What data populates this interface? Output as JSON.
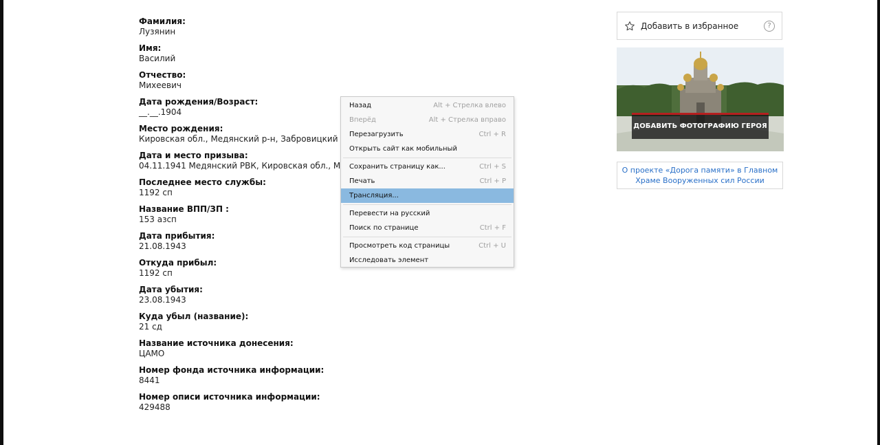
{
  "fields": [
    {
      "label": "Фамилия:",
      "value": "Лузянин"
    },
    {
      "label": "Имя:",
      "value": "Василий"
    },
    {
      "label": "Отчество:",
      "value": "Михеевич"
    },
    {
      "label": "Дата рождения/Возраст:",
      "value": "__.__.1904"
    },
    {
      "label": "Место рождения:",
      "value": "Кировская обл., Медянский р-н, Забровицкий с/с"
    },
    {
      "label": "Дата и место призыва:",
      "value": "04.11.1941 Медянский РВК, Кировская обл., Медянский р-н"
    },
    {
      "label": "Последнее место службы:",
      "value": "1192 сп"
    },
    {
      "label": "Название ВПП/ЗП :",
      "value": "153 азсп"
    },
    {
      "label": "Дата прибытия:",
      "value": "21.08.1943"
    },
    {
      "label": "Откуда прибыл:",
      "value": "1192 сп"
    },
    {
      "label": "Дата убытия:",
      "value": "23.08.1943"
    },
    {
      "label": "Куда убыл (название):",
      "value": "21 сд"
    },
    {
      "label": "Название источника донесения:",
      "value": "ЦАМО"
    },
    {
      "label": "Номер фонда источника информации:",
      "value": "8441"
    },
    {
      "label": "Номер описи источника информации:",
      "value": "429488"
    }
  ],
  "sidebar": {
    "favorite_label": "Добавить в избранное",
    "help_glyph": "?",
    "banner_cta": "ДОБАВИТЬ ФОТОГРАФИЮ ГЕРОЯ",
    "about_link": "О проекте «Дорога памяти» в Главном Храме Вооруженных сил России"
  },
  "context_menu": {
    "items": [
      {
        "label": "Назад",
        "shortcut": "Alt + Стрелка влево"
      },
      {
        "label": "Вперёд",
        "shortcut": "Alt + Стрелка вправо",
        "disabled": true
      },
      {
        "label": "Перезагрузить",
        "shortcut": "Ctrl + R"
      },
      {
        "label": "Открыть сайт как мобильный",
        "shortcut": ""
      },
      {
        "label": "Сохранить страницу как...",
        "shortcut": "Ctrl + S"
      },
      {
        "label": "Печать",
        "shortcut": "Ctrl + P"
      },
      {
        "label": "Трансляция...",
        "shortcut": "",
        "highlighted": true
      },
      {
        "label": "Перевести на русский",
        "shortcut": ""
      },
      {
        "label": "Поиск по странице",
        "shortcut": "Ctrl + F"
      },
      {
        "label": "Просмотреть код страницы",
        "shortcut": "Ctrl + U"
      },
      {
        "label": "Исследовать элемент",
        "shortcut": ""
      }
    ]
  },
  "colors": {
    "link": "#2a70c8",
    "menu_highlight": "#8ab9e0",
    "banner_accent": "#b51f1f"
  },
  "icons": {
    "favorite": "star-outline-icon",
    "help": "question-circle-icon"
  }
}
